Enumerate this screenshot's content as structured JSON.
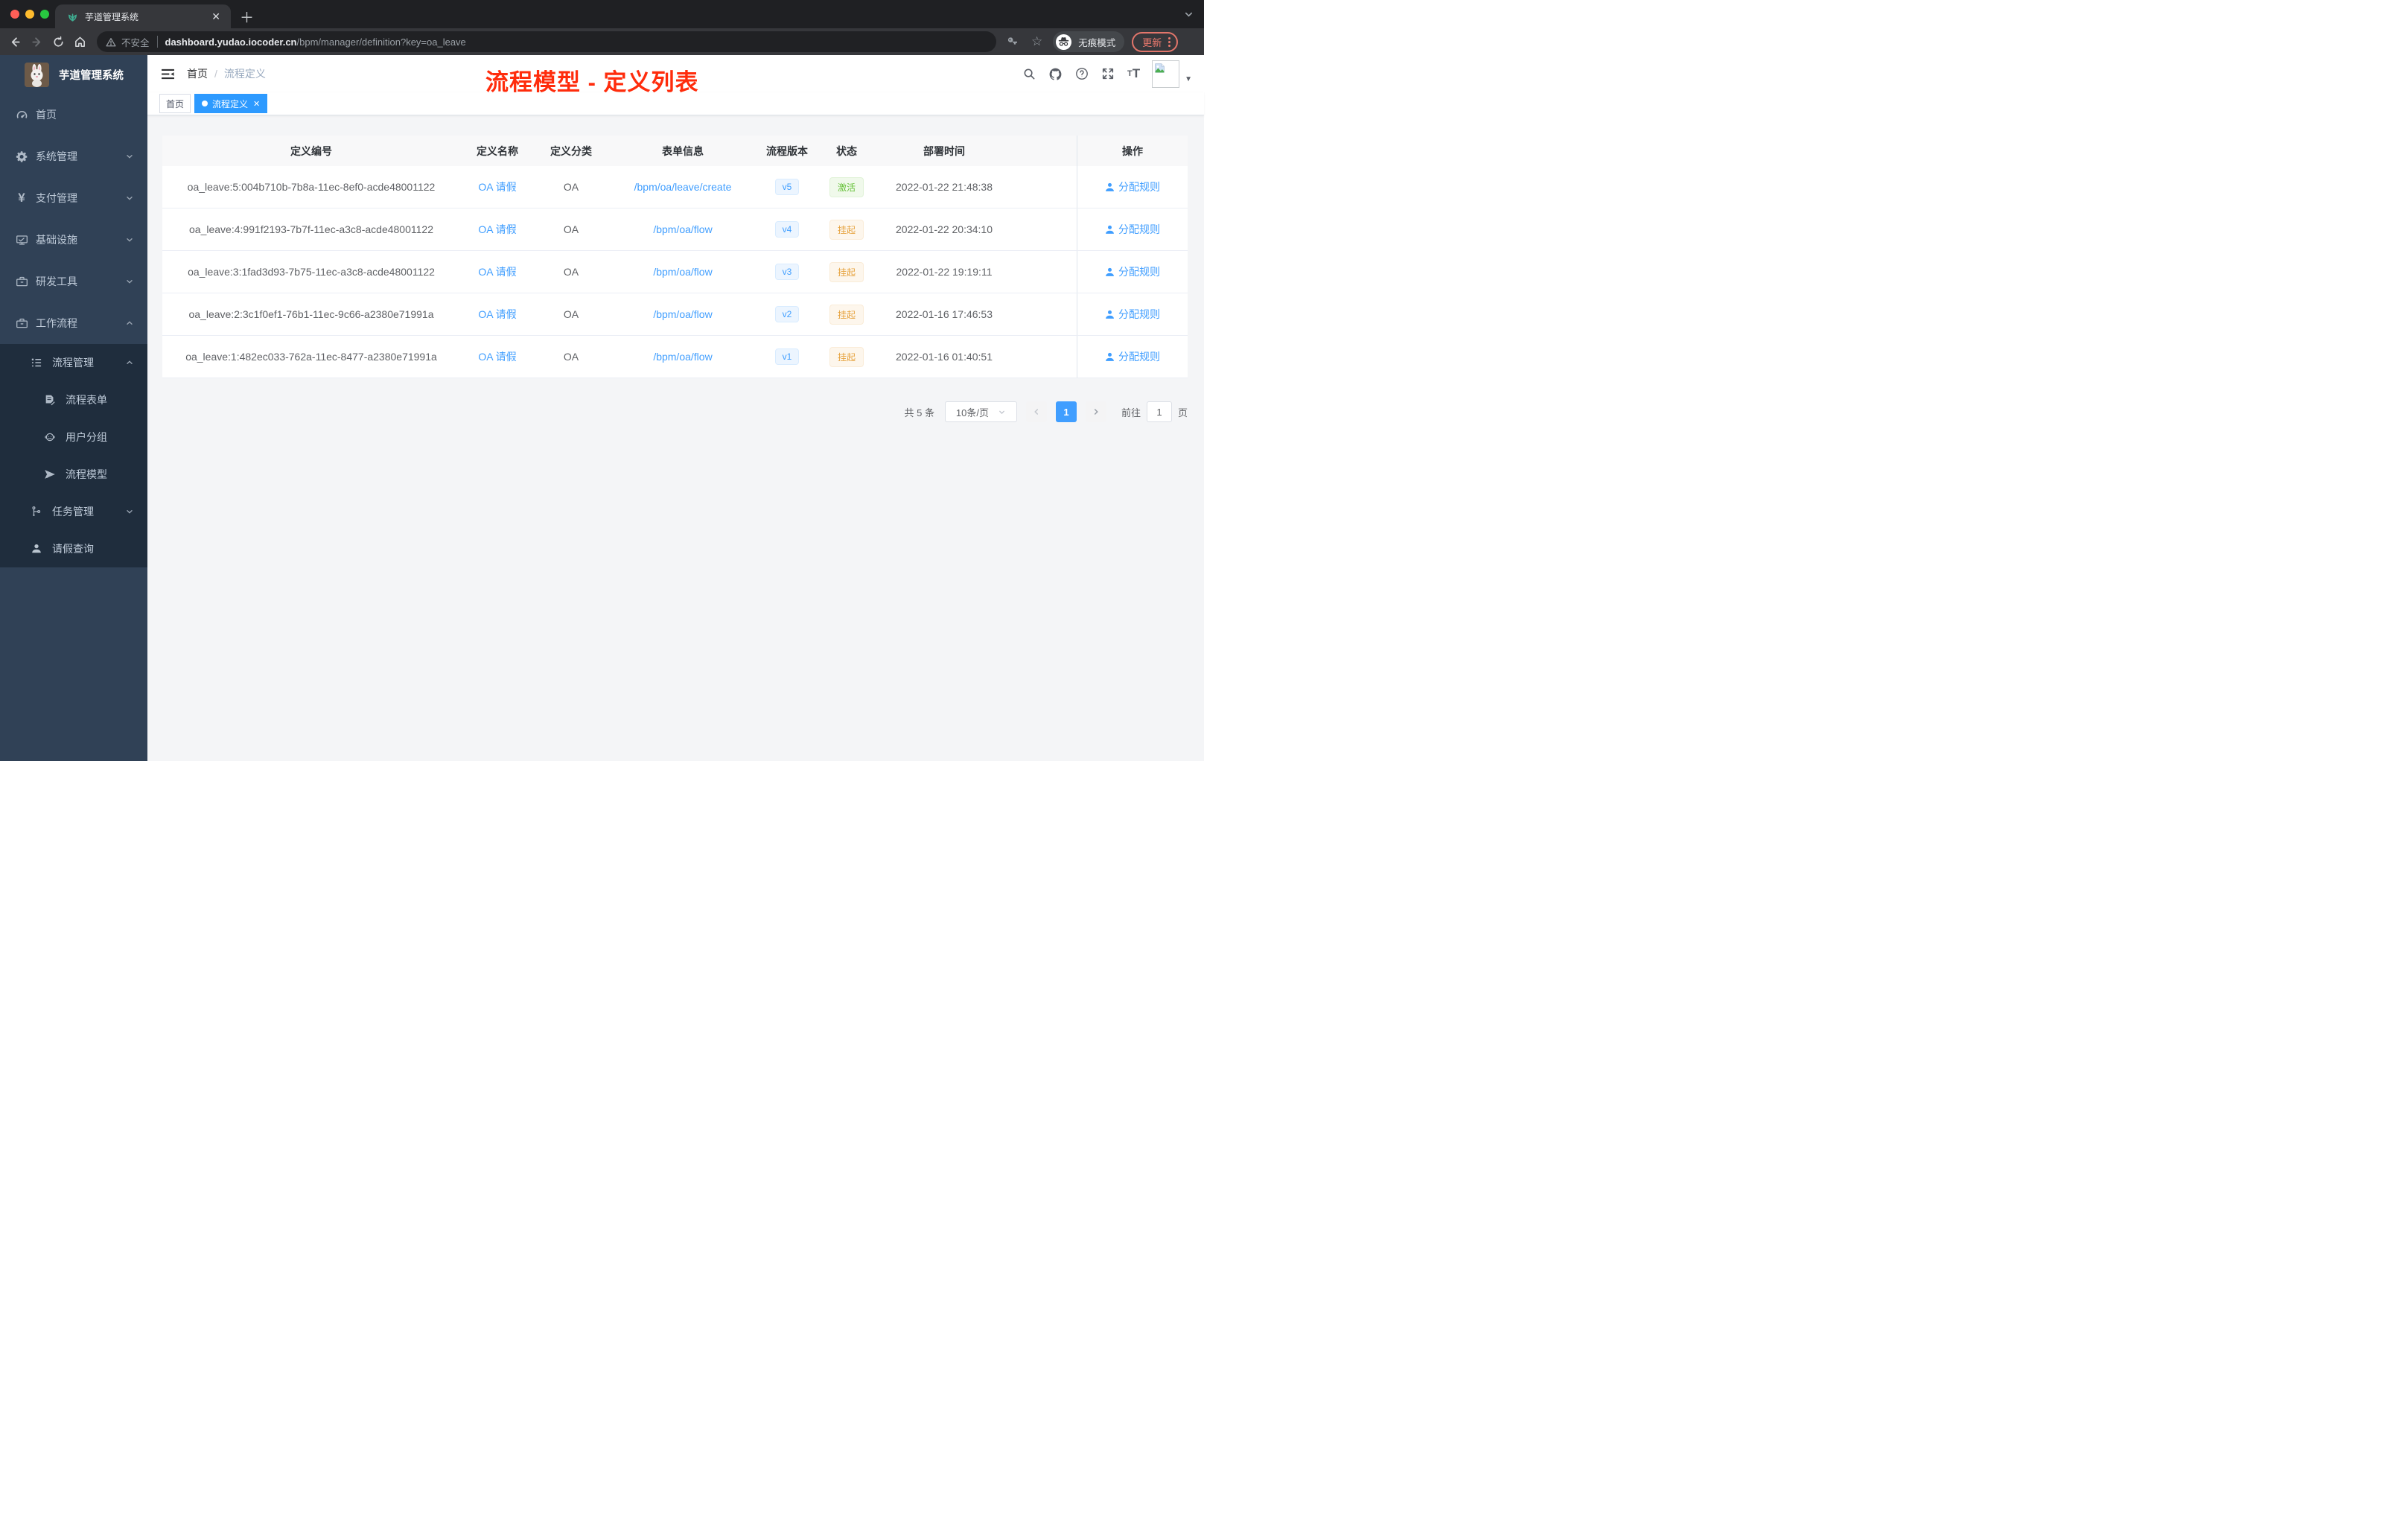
{
  "browser": {
    "tab_title": "芋道管理系统",
    "not_secure_label": "不安全",
    "url_host": "dashboard.yudao.iocoder.cn",
    "url_path": "/bpm/manager/definition?key=oa_leave",
    "incognito_label": "无痕模式",
    "update_label": "更新"
  },
  "header": {
    "breadcrumb_home": "首页",
    "breadcrumb_current": "流程定义",
    "annotation": "流程模型 - 定义列表"
  },
  "tags": {
    "home": "首页",
    "current": "流程定义"
  },
  "sidebar": {
    "title": "芋道管理系统",
    "items": [
      {
        "label": "首页"
      },
      {
        "label": "系统管理"
      },
      {
        "label": "支付管理"
      },
      {
        "label": "基础设施"
      },
      {
        "label": "研发工具"
      },
      {
        "label": "工作流程"
      }
    ],
    "sub": [
      {
        "label": "流程管理"
      },
      {
        "label": "流程表单"
      },
      {
        "label": "用户分组"
      },
      {
        "label": "流程模型"
      },
      {
        "label": "任务管理"
      },
      {
        "label": "请假查询"
      }
    ]
  },
  "table": {
    "columns": [
      "定义编号",
      "定义名称",
      "定义分类",
      "表单信息",
      "流程版本",
      "状态",
      "部署时间",
      "操作"
    ],
    "rows": [
      {
        "id": "oa_leave:5:004b710b-7b8a-11ec-8ef0-acde48001122",
        "name": "OA 请假",
        "category": "OA",
        "form": "/bpm/oa/leave/create",
        "version": "v5",
        "status": "激活",
        "time": "2022-01-22 21:48:38",
        "action": "分配规则"
      },
      {
        "id": "oa_leave:4:991f2193-7b7f-11ec-a3c8-acde48001122",
        "name": "OA 请假",
        "category": "OA",
        "form": "/bpm/oa/flow",
        "version": "v4",
        "status": "挂起",
        "time": "2022-01-22 20:34:10",
        "action": "分配规则"
      },
      {
        "id": "oa_leave:3:1fad3d93-7b75-11ec-a3c8-acde48001122",
        "name": "OA 请假",
        "category": "OA",
        "form": "/bpm/oa/flow",
        "version": "v3",
        "status": "挂起",
        "time": "2022-01-22 19:19:11",
        "action": "分配规则"
      },
      {
        "id": "oa_leave:2:3c1f0ef1-76b1-11ec-9c66-a2380e71991a",
        "name": "OA 请假",
        "category": "OA",
        "form": "/bpm/oa/flow",
        "version": "v2",
        "status": "挂起",
        "time": "2022-01-16 17:46:53",
        "action": "分配规则"
      },
      {
        "id": "oa_leave:1:482ec033-762a-11ec-8477-a2380e71991a",
        "name": "OA 请假",
        "category": "OA",
        "form": "/bpm/oa/flow",
        "version": "v1",
        "status": "挂起",
        "time": "2022-01-16 01:40:51",
        "action": "分配规则"
      }
    ]
  },
  "pagination": {
    "total_label": "共 5 条",
    "page_size_label": "10条/页",
    "current_page": "1",
    "goto_label": "前往",
    "goto_value": "1",
    "page_unit": "页"
  },
  "colors": {
    "primary": "#409eff",
    "success": "#67c23a",
    "warning": "#e6a23c",
    "sidebar_bg": "#304156",
    "submenu_bg": "#1f2d3d",
    "annotation_red": "#ff2c0c"
  }
}
